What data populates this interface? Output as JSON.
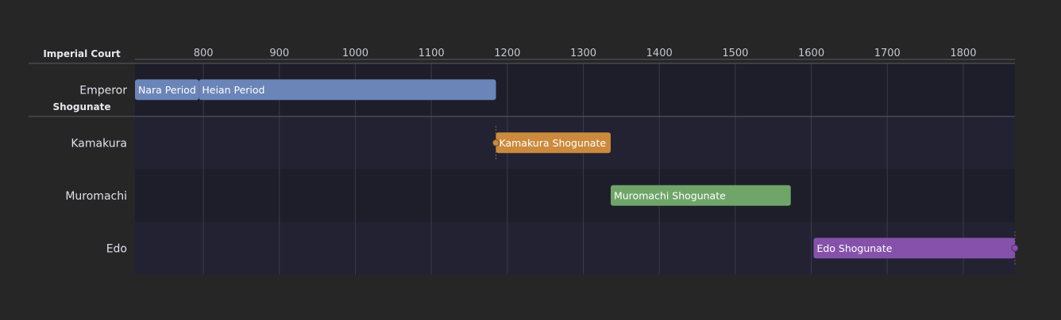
{
  "chart_data": {
    "type": "timeline",
    "x": {
      "min": 710,
      "max": 1868,
      "ticks": [
        800,
        900,
        1000,
        1100,
        1200,
        1300,
        1400,
        1500,
        1600,
        1700,
        1800
      ]
    },
    "groups": [
      {
        "name": "Imperial Court",
        "rows": [
          "Emperor"
        ]
      },
      {
        "name": "Shogunate",
        "rows": [
          "Kamakura",
          "Muromachi",
          "Edo"
        ]
      }
    ],
    "bars": [
      {
        "row": "Emperor",
        "label": "Nara Period",
        "start": 710,
        "end": 794,
        "color": "#6b85b8"
      },
      {
        "row": "Emperor",
        "label": "Heian Period",
        "start": 794,
        "end": 1185,
        "color": "#6b85b8"
      },
      {
        "row": "Kamakura",
        "label": "Kamakura Shogunate",
        "start": 1185,
        "end": 1336,
        "color": "#cc8a3c",
        "start_marker": true
      },
      {
        "row": "Muromachi",
        "label": "Muromachi Shogunate",
        "start": 1336,
        "end": 1573,
        "color": "#6fa569"
      },
      {
        "row": "Edo",
        "label": "Edo Shogunate",
        "start": 1603,
        "end": 1868,
        "color": "#8551ab",
        "end_marker": true
      }
    ]
  }
}
